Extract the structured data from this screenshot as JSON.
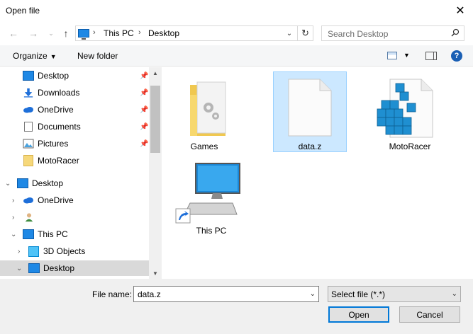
{
  "window": {
    "title": "Open file"
  },
  "address": {
    "crumbs": [
      "This PC",
      "Desktop"
    ],
    "search_placeholder": "Search Desktop"
  },
  "toolbar": {
    "organize_label": "Organize",
    "new_folder_label": "New folder",
    "help_label": "?"
  },
  "nav": {
    "quick_access": [
      {
        "label": "Desktop",
        "icon": "desktop-icon",
        "pinned": true
      },
      {
        "label": "Downloads",
        "icon": "download-icon",
        "pinned": true
      },
      {
        "label": "OneDrive",
        "icon": "onedrive-icon",
        "pinned": true
      },
      {
        "label": "Documents",
        "icon": "documents-icon",
        "pinned": true
      },
      {
        "label": "Pictures",
        "icon": "pictures-icon",
        "pinned": true
      },
      {
        "label": "MotoRacer",
        "icon": "folder-icon",
        "pinned": false
      }
    ],
    "tree": [
      {
        "label": "Desktop",
        "icon": "desktop-icon",
        "expanded": true
      },
      {
        "label": "OneDrive",
        "icon": "onedrive-icon",
        "expanded": false
      },
      {
        "label": "",
        "icon": "user-icon",
        "expanded": false
      },
      {
        "label": "This PC",
        "icon": "this-pc-icon",
        "expanded": true
      },
      {
        "label": "3D Objects",
        "icon": "3d-objects-icon",
        "expanded": false
      },
      {
        "label": "Desktop",
        "icon": "desktop-icon",
        "expanded": false,
        "selected": true
      }
    ]
  },
  "files": [
    {
      "name": "Games",
      "type": "folder",
      "icon": "folder-icon"
    },
    {
      "name": "data.z",
      "type": "file",
      "icon": "file-icon",
      "selected": true
    },
    {
      "name": "MotoRacer",
      "type": "file",
      "icon": "registry-icon"
    },
    {
      "name": "This PC",
      "type": "shortcut",
      "icon": "this-pc-icon"
    }
  ],
  "bottom": {
    "file_name_label": "File name:",
    "file_name_value": "data.z",
    "filter_value": "Select file (*.*)",
    "open_label": "Open",
    "cancel_label": "Cancel"
  }
}
